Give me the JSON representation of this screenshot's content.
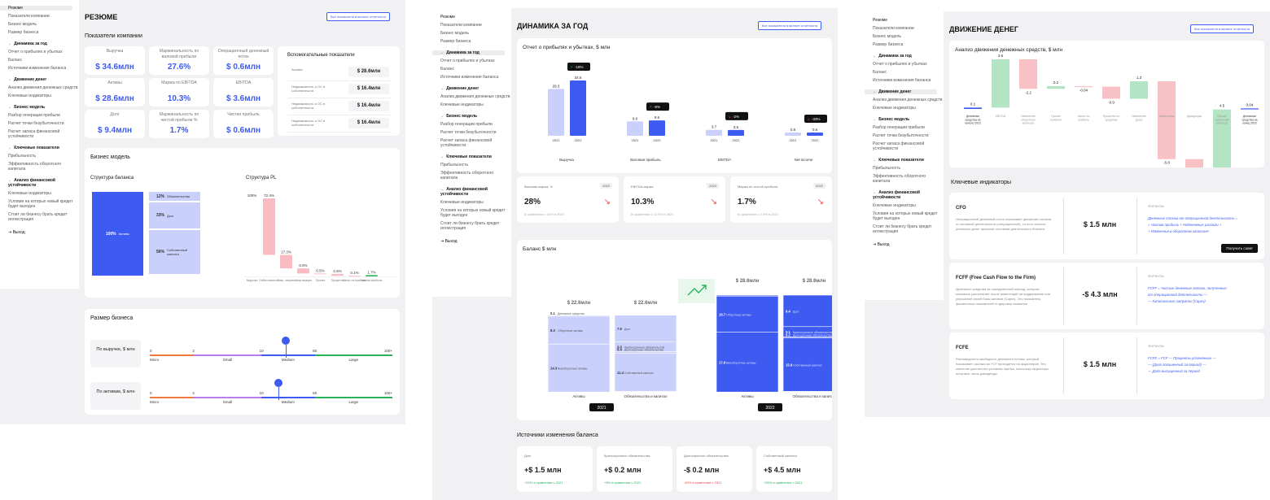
{
  "sidebar": {
    "top_items": [
      "Резюме",
      "Показатели компании",
      "Бизнес модель",
      "Размер бизнеса"
    ],
    "sections": [
      {
        "title": "Динамика за год",
        "items": [
          "Отчет о прибылях и убытках",
          "Баланс",
          "Источники изменения баланса"
        ]
      },
      {
        "title": "Движение денег",
        "items": [
          "Анализ движения денежных средств",
          "Ключевые индикаторы"
        ]
      },
      {
        "title": "Бизнес модель",
        "items": [
          "Разбор генерации прибыли",
          "Расчет точки безубыточности",
          "Расчет запаса финансовой устойчивости"
        ]
      },
      {
        "title": "Ключевые показатели",
        "items": [
          "Прибыльность",
          "Эффективность оборотного капитала"
        ]
      },
      {
        "title": "Анализ финансовой устойчивости",
        "items": [
          "Ключевые индикаторы",
          "Условия на которых новый кредит будет выгоден",
          "Стоит ли бизнесу брать кредит иллюстрация"
        ]
      }
    ],
    "exit": "Выход"
  },
  "common": {
    "export_btn": "Все показатели в валюте отчетности"
  },
  "p1": {
    "title": "РЕЗЮМЕ",
    "kpi_title": "Показатели компании",
    "kpis": [
      {
        "label": "Выручка",
        "value": "$ 34.6млн"
      },
      {
        "label": "Маржинальность по валовой прибыли",
        "value": "27.6%"
      },
      {
        "label": "Операционный денежный поток",
        "value": "$ 0.6млн"
      },
      {
        "label": "Активы",
        "value": "$ 28.6млн"
      },
      {
        "label": "Маржа по EBITDA",
        "value": "10.3%"
      },
      {
        "label": "EBITDA",
        "value": "$ 3.6млн"
      },
      {
        "label": "Долг",
        "value": "$ 9.4млн"
      },
      {
        "label": "Маржинальность по чистой прибыли %",
        "value": "1.7%"
      },
      {
        "label": "Чистая прибыль",
        "value": "$ 0.6млн"
      }
    ],
    "aux_title": "Вспомогательные показатели",
    "aux": [
      {
        "label": "Активы",
        "value": "$ 28.6млн"
      },
      {
        "label": "Недвижимость и ОС в собственности",
        "value": "$ 16.4млн"
      },
      {
        "label": "Недвижимость и ОС в собственности",
        "value": "$ 16.4млн"
      },
      {
        "label": "Недвижимость и ОС в собственности",
        "value": "$ 16.4млн"
      }
    ],
    "bm_title": "Бизнес модель",
    "balance_title": "Структура баланса",
    "balance_left": {
      "pct": "100%",
      "label": "Активы"
    },
    "balance_right": [
      {
        "pct": "12%",
        "label": "Обязательства"
      },
      {
        "pct": "33%",
        "label": "Долг"
      },
      {
        "pct": "56%",
        "label": "Собственный капитал"
      }
    ],
    "pl_title": "Структура PL",
    "pl_bars": [
      {
        "value": "100%",
        "label": "Выручка",
        "height": 100,
        "color": "#ffffff"
      },
      {
        "value": "72.4%",
        "label": "Себестоимость",
        "height": 72.4,
        "color": "#f8bcc2"
      },
      {
        "value": "17.3%",
        "label": "Опер. затраты",
        "height": 17.3,
        "color": "#f8bcc2"
      },
      {
        "value": "6.5%",
        "label": "Амортизация",
        "height": 6.5,
        "color": "#f8bcc2"
      },
      {
        "value": "0.5%",
        "label": "Прочее",
        "height": 0.5,
        "color": "#f8bcc2"
      },
      {
        "value": "2.5%",
        "label": "Проценты",
        "height": 2.5,
        "color": "#f8bcc2"
      },
      {
        "value": "0.1%",
        "label": "Налог на прибыль",
        "height": 0.1,
        "color": "#f8bcc2"
      },
      {
        "value": "1.7%",
        "label": "Чистая прибыль",
        "height": 1.7,
        "color": "#27b35a"
      }
    ],
    "size_title": "Размер бизнеса",
    "size_rows": [
      {
        "label": "По выручке, $ млн",
        "marker": 0.56
      },
      {
        "label": "По активам, $ млн",
        "marker": 0.53
      }
    ],
    "scale_ticks": [
      "0",
      "2",
      "10",
      "50",
      "100+"
    ],
    "scale_names": [
      "Micro",
      "Small",
      "Medium",
      "Large"
    ],
    "scale_colors": [
      "#f07a3a",
      "#b77ef2",
      "#3d5af1",
      "#27b35a"
    ]
  },
  "p2": {
    "title": "ДИНАМИКА ЗА ГОД",
    "pnl_title": "Отчет о прибылях и убытках, $ млн",
    "pnl_groups": [
      {
        "name": "Выручка",
        "v2021": "29.3",
        "v2022": "34.6",
        "change": "-18%",
        "trend": "up"
      },
      {
        "name": "Валовая прибыль",
        "v2021": "9.0",
        "v2022": "9.6",
        "change": "-6%",
        "trend": "up"
      },
      {
        "name": "EBITDA",
        "v2021": "3.7",
        "v2022": "3.6",
        "change": "-2%",
        "trend": "down"
      },
      {
        "name": "Net income",
        "v2021": "0.9",
        "v2022": "0.6",
        "change": "-33%",
        "trend": "down"
      }
    ],
    "year_a": "2021",
    "year_b": "2022",
    "margins": [
      {
        "label": "Валовая маржа, %",
        "year": "2022",
        "value": "28%",
        "note": "В сравнении с 33% в 2021"
      },
      {
        "label": "EBITDA маржа",
        "year": "2022",
        "value": "10.3%",
        "note": "В сравнении с 12.5% в 2021"
      },
      {
        "label": "Маржа по чистой прибыли",
        "year": "2022",
        "value": "1.7%",
        "note": "В сравнении с 2.9% в 2021"
      }
    ],
    "bal_title": "Баланс $ млн",
    "bal_2021_assets": "$ 22.6млн",
    "bal_2021_liab": "$ 22.6млн",
    "bal_2022_assets": "$ 28.6млн",
    "bal_2022_liab": "$ 28.6млн",
    "a21": [
      {
        "v": "0.1",
        "l": "Денежные средства"
      },
      {
        "v": "8.3",
        "l": "Оборотные активы"
      },
      {
        "v": "14.3",
        "l": "Внеоборотные активы"
      }
    ],
    "l21": [
      {
        "v": "7.9",
        "l": "Долг"
      },
      {
        "v": "3.0",
        "l": "Краткосрочные обязательства"
      },
      {
        "v": "0.4",
        "l": "Долгосрочные обязательства"
      },
      {
        "v": "11.4",
        "l": "Собственный капитал"
      }
    ],
    "a22": [
      {
        "v": "0.05",
        "l": "Денежные средства"
      },
      {
        "v": "10.7",
        "l": "Оборотные активы"
      },
      {
        "v": "17.9",
        "l": "Внеоборотные активы"
      }
    ],
    "l22": [
      {
        "v": "9.4",
        "l": "Долг"
      },
      {
        "v": "3.1",
        "l": "Краткосрочные обязательства"
      },
      {
        "v": "0.2",
        "l": "Долгосрочные обязательства"
      },
      {
        "v": "15.9",
        "l": "Собственный капитал"
      }
    ],
    "col_assets": "Активы",
    "col_liab": "Обязательства и капитал",
    "src_title": "Источники изменения баланса",
    "sources": [
      {
        "label": "Долг",
        "value": "+$ 1.5 млн",
        "note": "+15% в сравнении с 2021",
        "color": "#27b35a"
      },
      {
        "label": "Краткосрочные обязательства",
        "value": "+$ 0.2 млн",
        "note": "+5% в сравнении с 2021",
        "color": "#27b35a"
      },
      {
        "label": "Долгосрочные обязательства",
        "value": "-$ 0.2 млн",
        "note": "-40% в сравнении с 2021",
        "color": "#e5484d"
      },
      {
        "label": "Собственный капитал",
        "value": "+$ 4.5 млн",
        "note": "+39% в сравнении с 2021",
        "color": "#27b35a"
      }
    ]
  },
  "p3": {
    "title": "ДВИЖЕНИЕ ДЕНЕГ",
    "cf_title": "Анализ движения денежных средств, $ млн",
    "cf_chart": {
      "type": "bar",
      "categories": [
        "Денежные средства на начало 2022",
        "EBITDA",
        "Изменение оборотного капитала",
        "Прочие прибыли",
        "Налог на прибыль",
        "Проценты по кредитам",
        "Изменение долга",
        "Инвестиции",
        "Дивиденды",
        "Прочие изменения капитала",
        "Денежные средства на конец 2022"
      ],
      "values": [
        0.1,
        3.6,
        -2.2,
        0.2,
        -0.04,
        -0.9,
        1.3,
        -5.8,
        -0.8,
        4.5,
        0.04
      ],
      "labels": [
        "0.1",
        "3.6",
        "-2.2",
        "0.2",
        "-0.04",
        "-0.9",
        "1.3",
        "-5.8",
        "-0.8",
        "4.5",
        "0.04"
      ]
    },
    "ki_title": "Ключевые индикаторы",
    "formula_label": "ФОРМУЛА",
    "indicators": [
      {
        "name": "CFO",
        "desc": "Операционный денежный поток показывает движение потоков от основной деятельности (операционной), то есть сколько реальных денег приносит основная деятельность бизнеса",
        "value": "$ 1.5 млн",
        "formula": [
          "Денежные потоки от операционной деятельности =",
          "= Чистая прибыль + Неденежные расходы +",
          "+ Изменения в оборотном капитале"
        ],
        "button": "Получить совет"
      },
      {
        "name": "FCFF (Free Cash Flow to the Firm)",
        "desc": "Денежные средства за определенный период, которые компания располагает после инвестиций на поддержание или улучшение своей базы активов (Capex). Это показатель финансовых показателей в здоровья компании",
        "value": "-$ 4.3 млн",
        "formula": [
          "FCFF = Чистые денежные потоки, полученные",
          "от операционной деятельности —",
          "— Капитальные затраты (Capex)"
        ],
        "button": ""
      },
      {
        "name": "FCFE",
        "desc": "Разновидность свободного денежного потока, который показывает сколько из FCF приходится на акционеров. Это значение достаточно условная оценка, поскольку акционеры получают лишь дивиденды",
        "value": "$ 1.5 млн",
        "formula": [
          "FCFE = FCF — Проценты уплаченные —",
          "— (Долг погашенный за период) —",
          "— Долг выпущенный за период"
        ],
        "button": ""
      }
    ]
  }
}
